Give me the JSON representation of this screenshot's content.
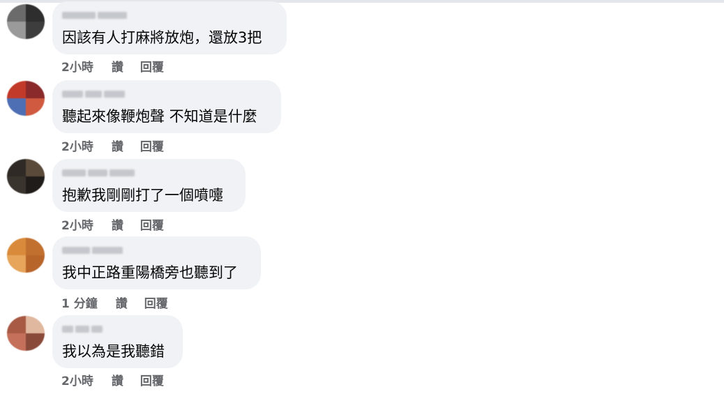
{
  "comments": [
    {
      "text": "因該有人打麻將放炮，還放3把",
      "time": "2小時",
      "like_label": "讚",
      "reply_label": "回覆",
      "avatar_colors": [
        "#6b6b6b",
        "#2e2e2e",
        "#9a9a9a",
        "#3d3d3d"
      ]
    },
    {
      "text": "聽起來像鞭炮聲 不知道是什麼",
      "time": "2小時",
      "like_label": "讚",
      "reply_label": "回覆",
      "avatar_colors": [
        "#c23a2a",
        "#8a2a2a",
        "#4f6fb5",
        "#d05a40"
      ]
    },
    {
      "text": "抱歉我剛剛打了一個噴嚏",
      "time": "2小時",
      "like_label": "讚",
      "reply_label": "回覆",
      "avatar_colors": [
        "#2f2a25",
        "#5a4a3a",
        "#3a342e",
        "#1f1c19"
      ]
    },
    {
      "text": "我中正路重陽橋旁也聽到了",
      "time": "1 分鐘",
      "like_label": "讚",
      "reply_label": "回覆",
      "avatar_colors": [
        "#d98a3a",
        "#c27030",
        "#e6a55a",
        "#b8652a"
      ]
    },
    {
      "text": "我以為是我聽錯",
      "time": "2小時",
      "like_label": "讚",
      "reply_label": "回覆",
      "avatar_colors": [
        "#a85a45",
        "#e0b8a0",
        "#c4705a",
        "#8a4a3a"
      ]
    }
  ]
}
